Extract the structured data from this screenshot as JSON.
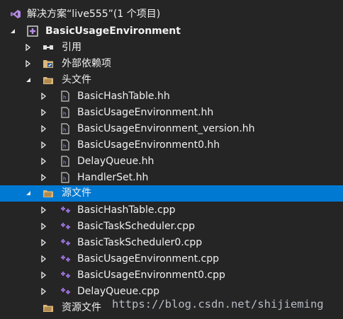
{
  "solution": {
    "label": "解决方案“live555”(1 个项目)"
  },
  "project": {
    "label": "BasicUsageEnvironment"
  },
  "references": {
    "label": "引用"
  },
  "external": {
    "label": "外部依赖项"
  },
  "headers": {
    "label": "头文件",
    "files": [
      "BasicHashTable.hh",
      "BasicUsageEnvironment.hh",
      "BasicUsageEnvironment_version.hh",
      "BasicUsageEnvironment0.hh",
      "DelayQueue.hh",
      "HandlerSet.hh"
    ]
  },
  "sources": {
    "label": "源文件",
    "files": [
      "BasicHashTable.cpp",
      "BasicTaskScheduler.cpp",
      "BasicTaskScheduler0.cpp",
      "BasicUsageEnvironment.cpp",
      "BasicUsageEnvironment0.cpp",
      "DelayQueue.cpp"
    ]
  },
  "resources": {
    "label": "资源文件"
  },
  "watermark": "https://blog.csdn.net/shijieming",
  "colors": {
    "background": "#252526",
    "selection": "#0079d3",
    "text": "#f1f1f1",
    "folder": "#dcb67a",
    "cpp": "#9b6fd6"
  }
}
